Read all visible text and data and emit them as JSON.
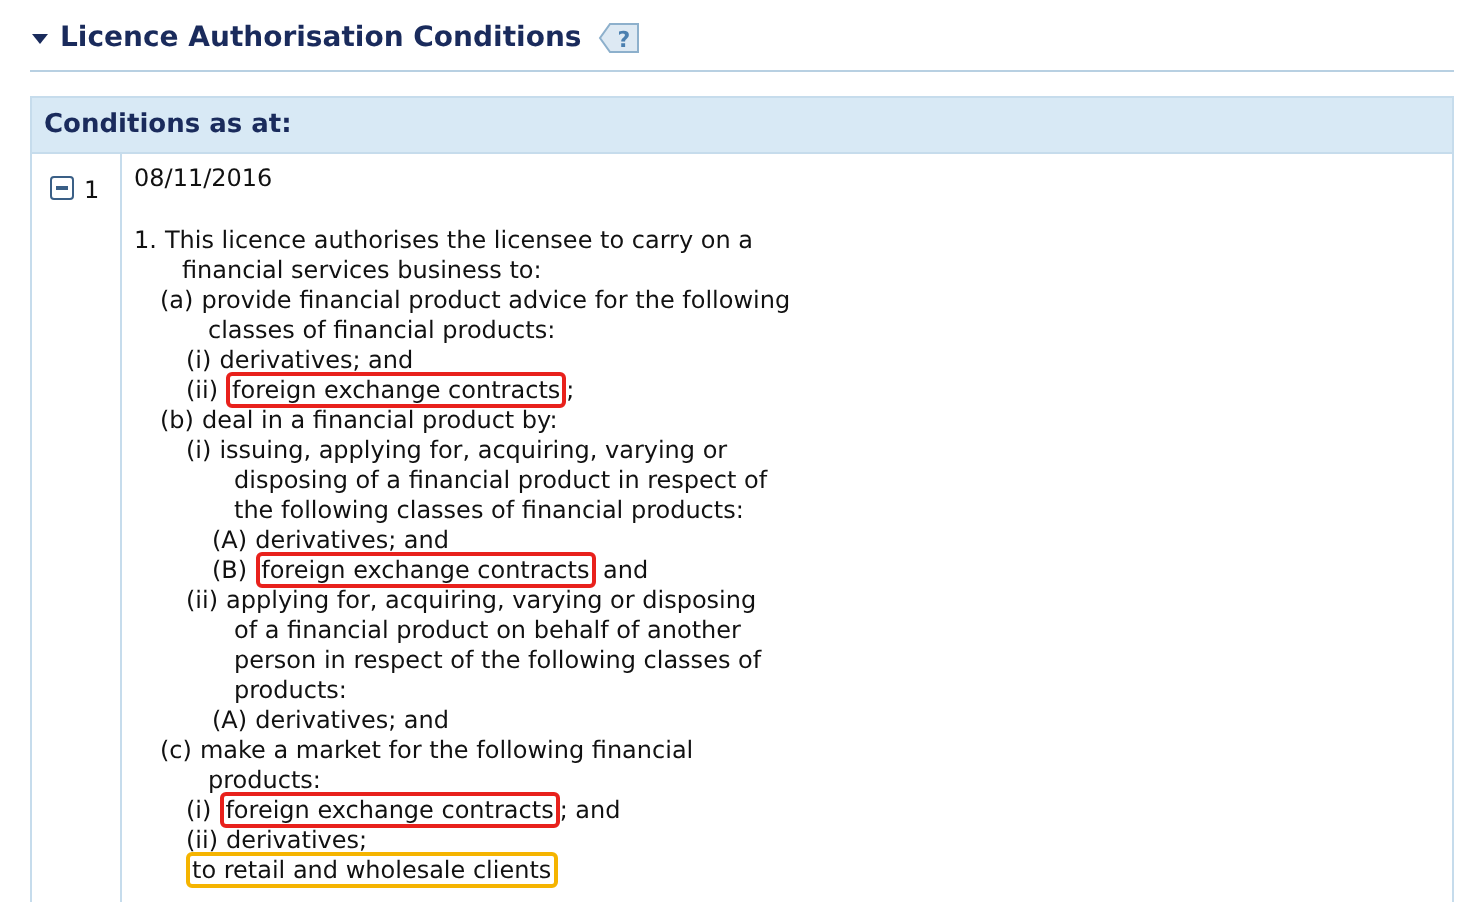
{
  "section": {
    "title": "Licence Authorisation Conditions",
    "expanded": true,
    "help": "?"
  },
  "table": {
    "header": "Conditions as at:",
    "rows": [
      {
        "number": "1",
        "expanded": true,
        "date": "08/11/2016",
        "conditions": [
          {
            "label": "1.",
            "lines": [
              [
                {
                  "text": "This licence authorises the licensee to carry on a"
                }
              ],
              [
                {
                  "text": "financial services business to:"
                }
              ]
            ],
            "children": [
              {
                "label": "(a)",
                "lines": [
                  [
                    {
                      "text": "provide financial product advice for the following"
                    }
                  ],
                  [
                    {
                      "text": "classes of financial products:"
                    }
                  ]
                ],
                "children": [
                  {
                    "label": "(i)",
                    "lines": [
                      [
                        {
                          "text": "derivatives; and"
                        }
                      ]
                    ]
                  },
                  {
                    "label": "(ii)",
                    "lines": [
                      [
                        {
                          "text": "foreign exchange contracts",
                          "color": "#e8211c"
                        },
                        {
                          "text": ";"
                        }
                      ]
                    ]
                  }
                ]
              },
              {
                "label": "(b)",
                "lines": [
                  [
                    {
                      "text": "deal in a financial product by:"
                    }
                  ]
                ],
                "children": [
                  {
                    "label": "(i)",
                    "lines": [
                      [
                        {
                          "text": "issuing, applying for, acquiring, varying or"
                        }
                      ],
                      [
                        {
                          "text": "disposing of a financial product in respect of"
                        }
                      ],
                      [
                        {
                          "text": "the following classes of financial products:"
                        }
                      ]
                    ],
                    "children": [
                      {
                        "label": "(A)",
                        "lines": [
                          [
                            {
                              "text": "derivatives; and"
                            }
                          ]
                        ]
                      },
                      {
                        "label": "(B)",
                        "lines": [
                          [
                            {
                              "text": "foreign exchange contracts",
                              "color": "#e8211c"
                            },
                            {
                              "text": " and"
                            }
                          ]
                        ]
                      }
                    ]
                  },
                  {
                    "label": "(ii)",
                    "lines": [
                      [
                        {
                          "text": "applying for, acquiring, varying or disposing"
                        }
                      ],
                      [
                        {
                          "text": "of a financial product on behalf of another"
                        }
                      ],
                      [
                        {
                          "text": "person in respect of the following classes of"
                        }
                      ],
                      [
                        {
                          "text": "products:"
                        }
                      ]
                    ],
                    "children": [
                      {
                        "label": "(A)",
                        "lines": [
                          [
                            {
                              "text": "derivatives; and"
                            }
                          ]
                        ]
                      }
                    ]
                  }
                ]
              },
              {
                "label": "(c)",
                "lines": [
                  [
                    {
                      "text": "make a market for the following financial"
                    }
                  ],
                  [
                    {
                      "text": "products:"
                    }
                  ]
                ],
                "children": [
                  {
                    "label": "(i)",
                    "lines": [
                      [
                        {
                          "text": "foreign exchange contracts",
                          "color": "#e8211c"
                        },
                        {
                          "text": "; and"
                        }
                      ]
                    ]
                  },
                  {
                    "label": "(ii)",
                    "lines": [
                      [
                        {
                          "text": "derivatives;"
                        }
                      ]
                    ]
                  }
                ]
              }
            ],
            "closing": [
              {
                "text": "to retail and wholesale clients",
                "color": "#f5b400"
              }
            ]
          }
        ]
      }
    ]
  }
}
